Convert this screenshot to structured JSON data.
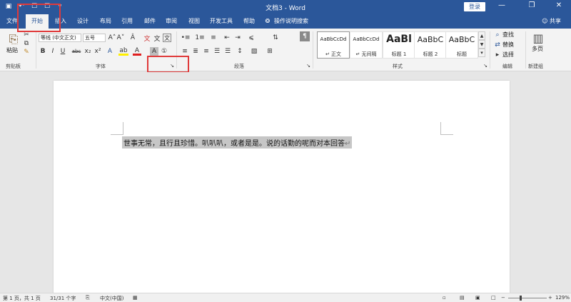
{
  "title_bar": {
    "title": "文档3 - Word",
    "login": "登录",
    "controls": [
      "—",
      "❐",
      "✕"
    ],
    "qat_icons": [
      "save-icon",
      "undo-icon",
      "redo-icon",
      "print-icon",
      "customize-icon"
    ],
    "qat_glyphs": [
      "▣",
      "↶",
      "☐",
      "☐",
      "▿"
    ]
  },
  "tabs": {
    "items": [
      "文件",
      "开始",
      "插入",
      "设计",
      "布局",
      "引用",
      "邮件",
      "审阅",
      "视图",
      "开发工具",
      "帮助"
    ],
    "active": "开始",
    "search_hint": "操作说明搜索",
    "lightbulb": "❂",
    "share": "共享",
    "share_glyph": "☺"
  },
  "ribbon": {
    "clipboard": {
      "paste": "粘贴",
      "label": "剪贴板",
      "glyphs": {
        "paste": "⎘",
        "cut": "✂",
        "copy": "⧉",
        "brush": "✎"
      }
    },
    "font": {
      "font_name": "等线 (中文正文)",
      "font_size": "五号",
      "glyphs": {
        "grow": "A˄",
        "shrink": "A˅",
        "clear": "Â",
        "wen": "文",
        "bold": "B",
        "italic": "I",
        "underline": "U",
        "strike": "abc",
        "sub": "x₂",
        "sup": "x²",
        "text_effects": "A",
        "highlight": "ab",
        "font_color": "A",
        "shade": "A",
        "border": "①"
      },
      "label": "字体",
      "launcher": "↘"
    },
    "paragraph": {
      "label": "段落",
      "launcher": "↘",
      "glyphs": {
        "bullets": "•≡",
        "numbering": "1≡",
        "multilevel": "≡",
        "decrease_indent": "⇤",
        "increase_indent": "⇥",
        "chinese_layout": "⩽",
        "sort": "⇅",
        "show_marks": "¶",
        "align_left": "≡",
        "center": "≣",
        "align_right": "≡",
        "justify": "☰",
        "distributed": "☰",
        "line_spacing": "↕",
        "shading": "▧",
        "borders": "⊞"
      }
    },
    "styles": {
      "items": [
        {
          "sample": "AaBbCcDd",
          "name": "↵ 正文"
        },
        {
          "sample": "AaBbCcDd",
          "name": "↵ 无间隔"
        },
        {
          "sample": "AaBl",
          "name": "标题 1"
        },
        {
          "sample": "AaBbC",
          "name": "标题 2"
        },
        {
          "sample": "AaBbC",
          "name": "标题"
        }
      ],
      "label": "样式",
      "launcher": "↘",
      "scroll": [
        "▲",
        "▼",
        "▾"
      ]
    },
    "editing": {
      "find": "查找",
      "replace": "替换",
      "select": "选择",
      "label": "编辑",
      "glyphs": {
        "find": "⌕",
        "replace": "⇄",
        "select": "▸"
      }
    },
    "new_group": {
      "multipage": "多页",
      "label": "新建组",
      "glyph": "▥"
    }
  },
  "document": {
    "text": "世事无常，且行且珍惜。叭叭叭，或者是是。说的话勤的呢而对本回答",
    "pilcrow": "↵"
  },
  "status": {
    "page": "第 1 页，共 1 页",
    "words": "31/31 个字",
    "lang": "中文(中国)",
    "zoom": "129%",
    "glyphs": {
      "track": "⎘",
      "macro": "▦",
      "focus": "▫",
      "read": "▤",
      "print": "▣",
      "web": "□",
      "minus": "−",
      "plus": "+"
    }
  },
  "colors": {
    "brand": "#2b579a",
    "highlight_box": "#e03a3a",
    "selection": "#c6c6c6"
  }
}
